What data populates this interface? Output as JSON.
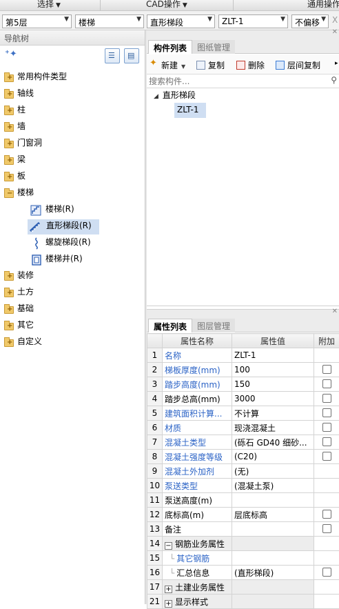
{
  "menubar": {
    "select_label": "选择",
    "cad_label": "CAD操作",
    "general_label": "通用操作"
  },
  "selectors": {
    "floor": "第5层",
    "category": "楼梯",
    "type": "直形梯段",
    "component": "ZLT-1",
    "offset": "不偏移"
  },
  "nav": {
    "title": "导航树",
    "items": [
      {
        "label": "常用构件类型"
      },
      {
        "label": "轴线"
      },
      {
        "label": "柱"
      },
      {
        "label": "墙"
      },
      {
        "label": "门窗洞"
      },
      {
        "label": "梁"
      },
      {
        "label": "板"
      },
      {
        "label": "楼梯"
      },
      {
        "label": "装修"
      },
      {
        "label": "土方"
      },
      {
        "label": "基础"
      },
      {
        "label": "其它"
      },
      {
        "label": "自定义"
      }
    ],
    "stair_children": [
      {
        "label": "楼梯(R)",
        "icon": "stair-icon"
      },
      {
        "label": "直形梯段(R)",
        "icon": "straight-flight-icon"
      },
      {
        "label": "螺旋梯段(R)",
        "icon": "spiral-flight-icon"
      },
      {
        "label": "楼梯井(R)",
        "icon": "stairwell-icon"
      }
    ]
  },
  "component_panel": {
    "tabs": [
      "构件列表",
      "图纸管理"
    ],
    "toolbar": {
      "new_label": "新建",
      "copy_label": "复制",
      "delete_label": "删除",
      "floor_copy_label": "层间复制"
    },
    "search_placeholder": "搜索构件...",
    "tree": {
      "group": "直形梯段",
      "item": "ZLT-1"
    }
  },
  "property_panel": {
    "tabs": [
      "属性列表",
      "图层管理"
    ],
    "headers": {
      "name": "属性名称",
      "value": "属性值",
      "add": "附加"
    },
    "rows": [
      {
        "no": "1",
        "name": "名称",
        "value": "ZLT-1",
        "blue": true,
        "check": false
      },
      {
        "no": "2",
        "name": "梯板厚度(mm)",
        "value": "100",
        "blue": true,
        "check": true
      },
      {
        "no": "3",
        "name": "踏步高度(mm)",
        "value": "150",
        "blue": true,
        "check": true
      },
      {
        "no": "4",
        "name": "踏步总高(mm)",
        "value": "3000",
        "blue": false,
        "check": true
      },
      {
        "no": "5",
        "name": "建筑面积计算...",
        "value": "不计算",
        "blue": true,
        "check": true
      },
      {
        "no": "6",
        "name": "材质",
        "value": "现浇混凝土",
        "blue": true,
        "check": true
      },
      {
        "no": "7",
        "name": "混凝土类型",
        "value": "(砾石 GD40 细砂...",
        "blue": true,
        "check": true
      },
      {
        "no": "8",
        "name": "混凝土强度等级",
        "value": "(C20)",
        "blue": true,
        "check": true
      },
      {
        "no": "9",
        "name": "混凝土外加剂",
        "value": "(无)",
        "blue": true,
        "check": false
      },
      {
        "no": "10",
        "name": "泵送类型",
        "value": "(混凝土泵)",
        "blue": true,
        "check": false
      },
      {
        "no": "11",
        "name": "泵送高度(m)",
        "value": "",
        "blue": false,
        "check": false
      },
      {
        "no": "12",
        "name": "底标高(m)",
        "value": "层底标高",
        "blue": false,
        "check": true
      },
      {
        "no": "13",
        "name": "备注",
        "value": "",
        "blue": false,
        "check": true
      }
    ],
    "group_rebar": {
      "no": "14",
      "toggle": "−",
      "name": "钢筋业务属性"
    },
    "rebar_rows": [
      {
        "no": "15",
        "name": "其它钢筋",
        "value": "",
        "blue": true,
        "check": false
      },
      {
        "no": "16",
        "name": "汇总信息",
        "value": "(直形梯段)",
        "blue": false,
        "check": true
      }
    ],
    "group_civil": {
      "no": "17",
      "toggle": "+",
      "name": "土建业务属性"
    },
    "group_display": {
      "no": "21",
      "toggle": "+",
      "name": "显示样式"
    }
  }
}
